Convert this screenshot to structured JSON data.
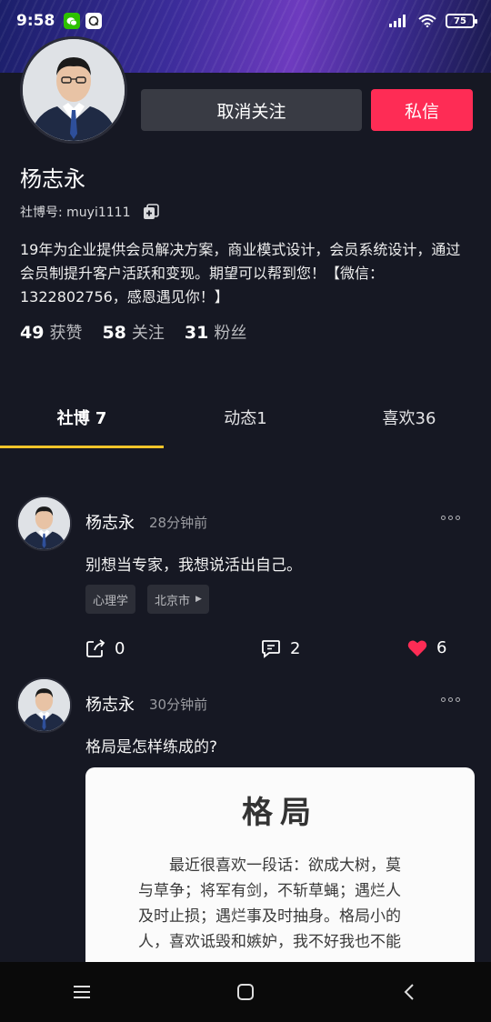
{
  "status_bar": {
    "time": "9:58",
    "battery": "75",
    "app_icons": [
      "wechat-icon",
      "qq-icon"
    ],
    "right_icons": [
      "signal-icon",
      "wifi-icon",
      "battery-icon"
    ]
  },
  "profile": {
    "name": "杨志永",
    "id_label": "社博号: muyi1111",
    "unfollow_label": "取消关注",
    "message_label": "私信",
    "bio": "19年为企业提供会员解决方案，商业模式设计，会员系统设计，通过会员制提升客户活跃和变现。期望可以帮到您！【微信：1322802756，感恩遇见你！】",
    "stats": [
      {
        "value": "49",
        "label": "获赞"
      },
      {
        "value": "58",
        "label": "关注"
      },
      {
        "value": "31",
        "label": "粉丝"
      }
    ]
  },
  "tabs": [
    {
      "label": "社博 7",
      "active": true
    },
    {
      "label": "动态1",
      "active": false
    },
    {
      "label": "喜欢36",
      "active": false
    }
  ],
  "posts": [
    {
      "author": "杨志永",
      "time": "28分钟前",
      "text": "别想当专家，我想说活出自己。",
      "tags": [
        "心理学",
        "北京市"
      ],
      "share_count": "0",
      "comment_count": "2",
      "like_count": "6"
    },
    {
      "author": "杨志永",
      "time": "30分钟前",
      "text": "格局是怎样练成的?",
      "image_title": "格局",
      "image_lines": [
        "　　最近很喜欢一段话：欲成大树，莫",
        "与草争；将军有剑，不斩草蝇；遇烂人",
        "及时止损；遇烂事及时抽身。格局小的",
        "人，喜欢诋毁和嫉妒，我不好我也不能"
      ]
    }
  ],
  "colors": {
    "background": "#161823",
    "accent_red": "#fe2c55",
    "tab_indicator": "#f7c52a",
    "like_heart": "#fe2c55"
  }
}
